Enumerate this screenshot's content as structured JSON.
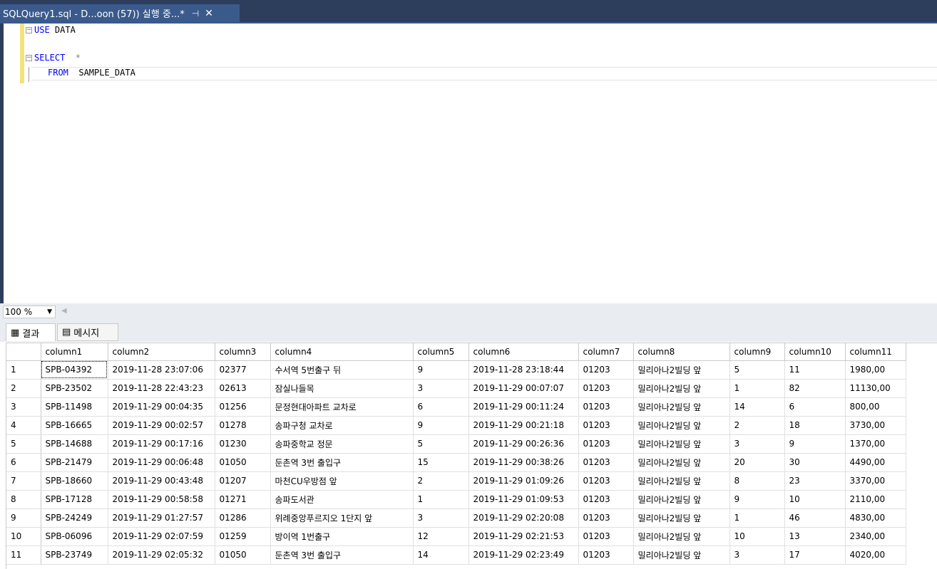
{
  "tab": {
    "title": "SQLQuery1.sql - D...oon (57)) 실행 중...*",
    "pin_icon": "pin-icon",
    "close_icon": "close-icon"
  },
  "editor": {
    "line1_kw": "USE",
    "line1_rest": " DATA",
    "line2_kw": "SELECT",
    "line2_rest": "  *",
    "line3_kw": "FROM",
    "line3_rest": "  SAMPLE_DATA"
  },
  "zoom": {
    "value": "100 %"
  },
  "result_tabs": [
    {
      "label": "결과",
      "icon": "grid-icon"
    },
    {
      "label": "메시지",
      "icon": "message-icon"
    }
  ],
  "grid": {
    "columns": [
      "",
      "column1",
      "column2",
      "column3",
      "column4",
      "column5",
      "column6",
      "column7",
      "column8",
      "column9",
      "column10",
      "column11"
    ],
    "rows": [
      [
        "1",
        "SPB-04392",
        "2019-11-28 23:07:06",
        "02377",
        "수서역 5번출구 뒤",
        "9",
        "2019-11-28 23:18:44",
        "01203",
        "밀리아나2빌딩 앞",
        "5",
        "11",
        "1980,00"
      ],
      [
        "2",
        "SPB-23502",
        "2019-11-28 22:43:23",
        "02613",
        "잠실나들목",
        "3",
        "2019-11-29 00:07:07",
        "01203",
        "밀리아나2빌딩 앞",
        "1",
        "82",
        "11130,00"
      ],
      [
        "3",
        "SPB-11498",
        "2019-11-29 00:04:35",
        "01256",
        "문정현대아파트 교차로",
        "6",
        "2019-11-29 00:11:24",
        "01203",
        "밀리아나2빌딩 앞",
        "14",
        "6",
        "800,00"
      ],
      [
        "4",
        "SPB-16665",
        "2019-11-29 00:02:57",
        "01278",
        "송파구청 교차로",
        "9",
        "2019-11-29 00:21:18",
        "01203",
        "밀리아나2빌딩 앞",
        "2",
        "18",
        "3730,00"
      ],
      [
        "5",
        "SPB-14688",
        "2019-11-29 00:17:16",
        "01230",
        "송파중학교 정문",
        "5",
        "2019-11-29 00:26:36",
        "01203",
        "밀리아나2빌딩 앞",
        "3",
        "9",
        "1370,00"
      ],
      [
        "6",
        "SPB-21479",
        "2019-11-29 00:06:48",
        "01050",
        "둔촌역 3번 출입구",
        "15",
        "2019-11-29 00:38:26",
        "01203",
        "밀리아나2빌딩 앞",
        "20",
        "30",
        "4490,00"
      ],
      [
        "7",
        "SPB-18660",
        "2019-11-29 00:43:48",
        "01207",
        "마천CU우방점 앞",
        "2",
        "2019-11-29 01:09:26",
        "01203",
        "밀리아나2빌딩 앞",
        "8",
        "23",
        "3370,00"
      ],
      [
        "8",
        "SPB-17128",
        "2019-11-29 00:58:58",
        "01271",
        "송파도서관",
        "1",
        "2019-11-29 01:09:53",
        "01203",
        "밀리아나2빌딩 앞",
        "9",
        "10",
        "2110,00"
      ],
      [
        "9",
        "SPB-24249",
        "2019-11-29 01:27:57",
        "01286",
        "위례중앙푸르지오 1단지 앞",
        "3",
        "2019-11-29 02:20:08",
        "01203",
        "밀리아나2빌딩 앞",
        "1",
        "46",
        "4830,00"
      ],
      [
        "10",
        "SPB-06096",
        "2019-11-29 02:07:59",
        "01259",
        "방이역 1번출구",
        "12",
        "2019-11-29 02:21:53",
        "01203",
        "밀리아나2빌딩 앞",
        "10",
        "13",
        "2340,00"
      ],
      [
        "11",
        "SPB-23749",
        "2019-11-29 02:05:32",
        "01050",
        "둔촌역 3번 출입구",
        "14",
        "2019-11-29 02:23:49",
        "01203",
        "밀리아나2빌딩 앞",
        "3",
        "17",
        "4020,00"
      ]
    ]
  }
}
